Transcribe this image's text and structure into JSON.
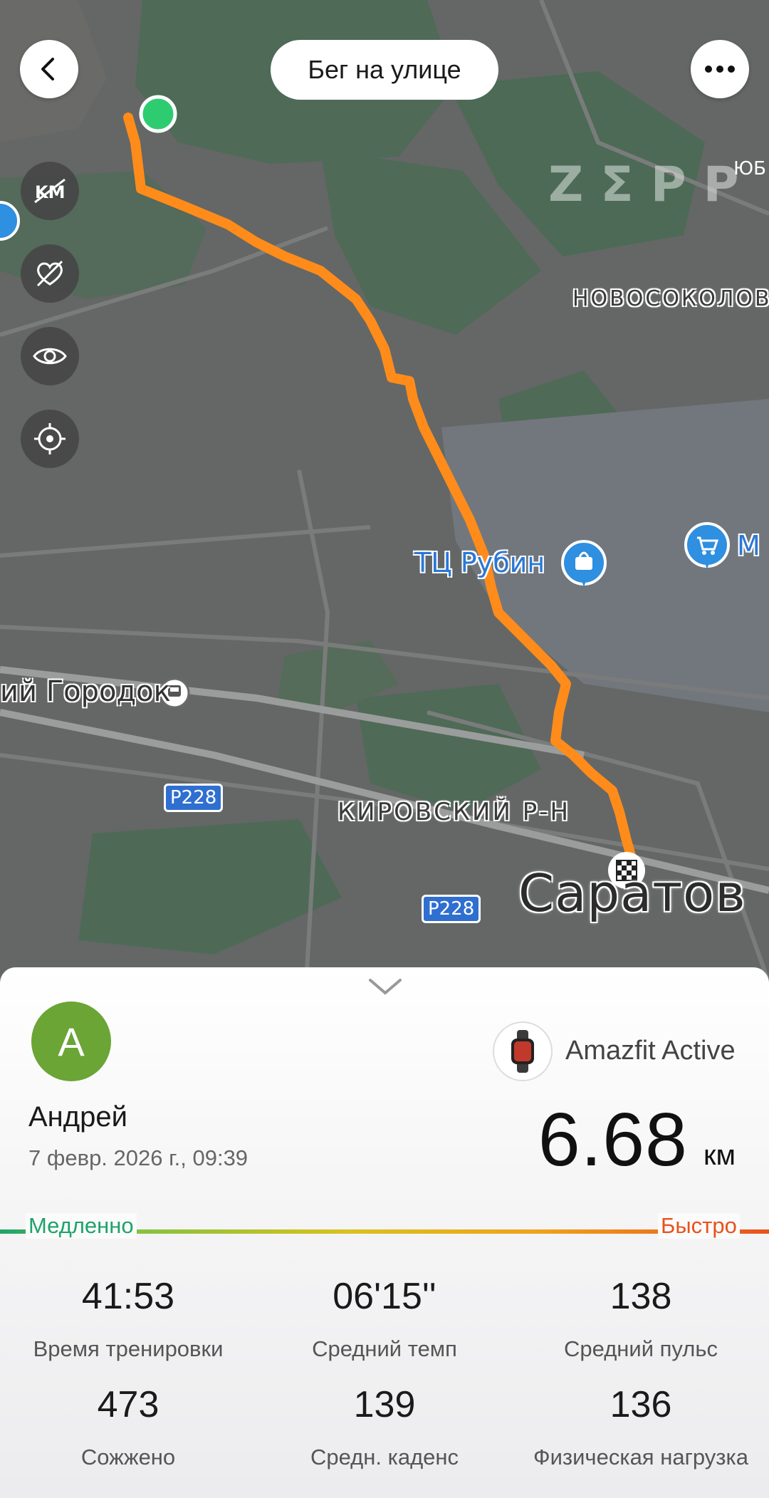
{
  "header": {
    "title": "Бег на улице",
    "back_icon": "chevron-left-icon",
    "more_icon": "more-horizontal-icon"
  },
  "map": {
    "watermark": "ZΣPP",
    "labels": {
      "corner_partial": "ЮБ",
      "district_top": "НОВОСОКОЛОВО",
      "poi_mall": "ТЦ Рубин",
      "poi_partial": "М",
      "metro": "ий Городок",
      "road_1": "Р228",
      "road_2": "Р228",
      "district": "КИРОВСКИЙ Р-Н",
      "city": "Саратов"
    },
    "tools": [
      "km-toggle-icon",
      "hide-heart-icon",
      "eye-icon",
      "locate-icon"
    ],
    "route_color": "#ff8c1a",
    "start_color": "#2ecc71"
  },
  "summary": {
    "collapse_icon": "chevron-down-icon",
    "avatar_letter": "A",
    "user_name": "Андрей",
    "datetime": "7 февр. 2026 г., 09:39",
    "device": "Amazfit Active",
    "distance": "6.68",
    "distance_unit": "км",
    "pace_slow": "Медленно",
    "pace_fast": "Быстро"
  },
  "stats": [
    {
      "value": "41:53",
      "label": "Время тренировки"
    },
    {
      "value": "06'15''",
      "label": "Средний темп"
    },
    {
      "value": "138",
      "label": "Средний пульс"
    },
    {
      "value": "473",
      "label": "Сожжено"
    },
    {
      "value": "139",
      "label": "Средн. каденс"
    },
    {
      "value": "136",
      "label": "Физическая нагрузка"
    }
  ],
  "colors": {
    "accent_green": "#1fa36a",
    "accent_red": "#e8521c",
    "avatar": "#6aa535"
  }
}
